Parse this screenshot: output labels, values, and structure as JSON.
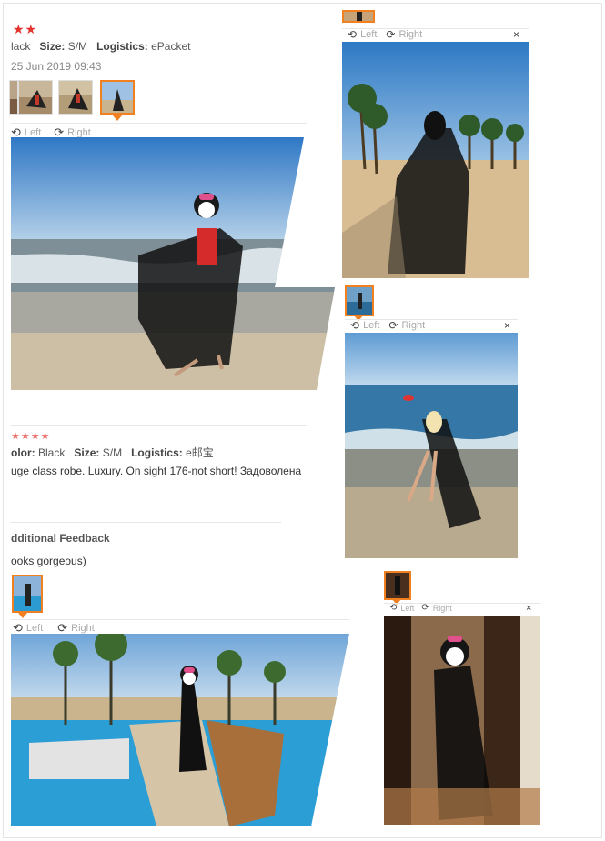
{
  "review1": {
    "stars": "★★",
    "color_label": "lack",
    "color_value": "",
    "size_label": "Size:",
    "size_value": "S/M",
    "logistics_label": "Logistics:",
    "logistics_value": "ePacket",
    "date": "25 Jun 2019 09:43",
    "viewer": {
      "left": "Left",
      "right": "Right"
    }
  },
  "review2": {
    "stars": "★★★★",
    "color_label": "olor:",
    "color_value": "Black",
    "size_label": "Size:",
    "size_value": "S/M",
    "logistics_label": "Logistics:",
    "logistics_value": "e邮宝",
    "text": "uge class robe. Luxury. On sight 176-not short! Задоволена",
    "feedback_title": "dditional Feedback",
    "feedback_text": "ooks gorgeous)",
    "viewer": {
      "left": "Left",
      "right": "Right"
    }
  },
  "popups": [
    {
      "left": "Left",
      "right": "Right",
      "close": "×"
    },
    {
      "left": "Left",
      "right": "Right",
      "close": "×"
    },
    {
      "left": "Left",
      "right": "Right",
      "close": "×"
    }
  ],
  "colors": {
    "accent": "#f08020",
    "star": "#e5322d"
  }
}
